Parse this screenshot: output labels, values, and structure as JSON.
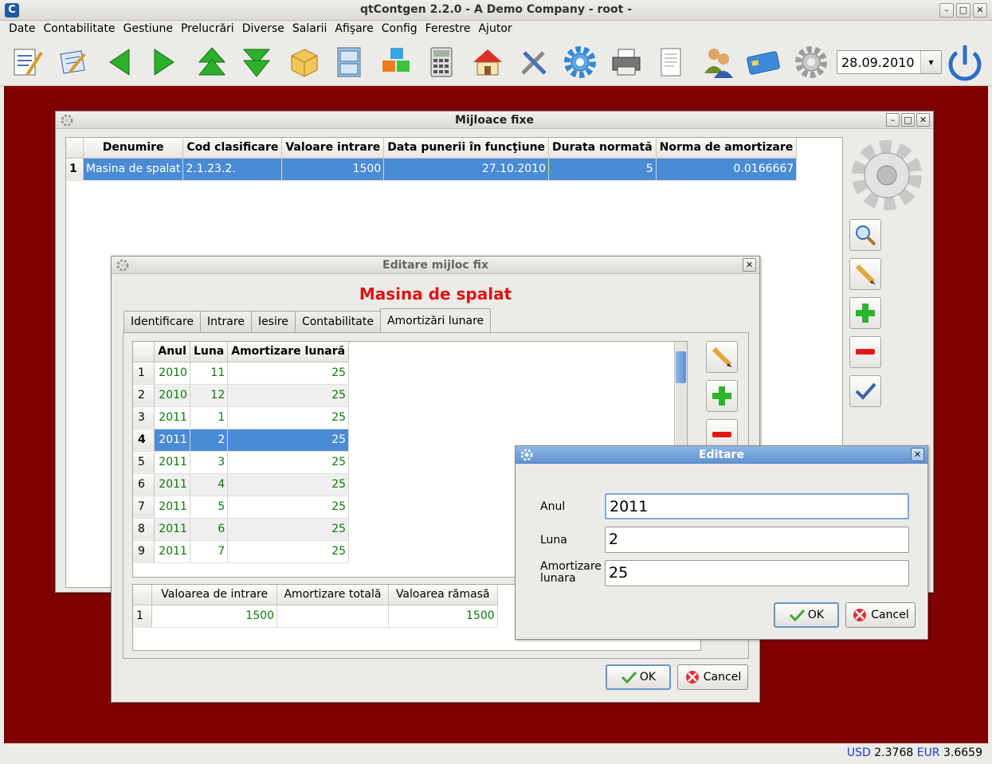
{
  "app": {
    "title": "qtContgen 2.2.0 - A Demo Company - root -",
    "logo_letter": "C",
    "menu": [
      "Date",
      "Contabilitate",
      "Gestiune",
      "Prelucrări",
      "Diverse",
      "Salarii",
      "Afişare",
      "Config",
      "Ferestre",
      "Ajutor"
    ],
    "date": "28.09.2010",
    "status": {
      "usd_label": "USD",
      "usd_value": "2.3768",
      "eur_label": "EUR",
      "eur_value": "3.6659"
    }
  },
  "toolbar": {
    "icons": [
      "document-edit-icon",
      "notepad-edit-icon",
      "arrow-left-icon",
      "arrow-right-icon",
      "arrow-up-icon",
      "arrow-down-icon",
      "box-icon",
      "cabinet-icon",
      "cubes-icon",
      "calculator-icon",
      "house-icon",
      "tools-icon",
      "gear-blue-icon",
      "printer-icon",
      "report-icon",
      "users-icon",
      "card-icon",
      "gear-grey-icon",
      "power-icon"
    ]
  },
  "mijloace": {
    "title": "Mijloace fixe",
    "columns": [
      "Denumire",
      "Cod clasificare",
      "Valoare intrare",
      "Data punerii în funcţiune",
      "Durata normată",
      "Norma de amortizare"
    ],
    "rows": [
      {
        "n": "1",
        "cells": [
          "Masina de spalat",
          "2.1.23.2.",
          "1500",
          "27.10.2010",
          "5",
          "0.0166667"
        ]
      }
    ]
  },
  "editare_mijloc": {
    "title": "Editare mijloc fix",
    "heading": "Masina de spalat",
    "tabs": [
      "Identificare",
      "Intrare",
      "Iesire",
      "Contabilitate",
      "Amortizări lunare"
    ],
    "active_tab": 4,
    "columns": [
      "Anul",
      "Luna",
      "Amortizare lunară"
    ],
    "rows": [
      {
        "n": "1",
        "anul": "2010",
        "luna": "11",
        "amort": "25"
      },
      {
        "n": "2",
        "anul": "2010",
        "luna": "12",
        "amort": "25"
      },
      {
        "n": "3",
        "anul": "2011",
        "luna": "1",
        "amort": "25"
      },
      {
        "n": "4",
        "anul": "2011",
        "luna": "2",
        "amort": "25"
      },
      {
        "n": "5",
        "anul": "2011",
        "luna": "3",
        "amort": "25"
      },
      {
        "n": "6",
        "anul": "2011",
        "luna": "4",
        "amort": "25"
      },
      {
        "n": "7",
        "anul": "2011",
        "luna": "5",
        "amort": "25"
      },
      {
        "n": "8",
        "anul": "2011",
        "luna": "6",
        "amort": "25"
      },
      {
        "n": "9",
        "anul": "2011",
        "luna": "7",
        "amort": "25"
      }
    ],
    "selected_row": 3,
    "summary_columns": [
      "Valoarea de intrare",
      "Amortizare totală",
      "Valoarea rămasă"
    ],
    "summary_rows": [
      {
        "n": "1",
        "cells": [
          "1500",
          "",
          "1500"
        ]
      }
    ],
    "ok_label": "OK",
    "cancel_label": "Cancel"
  },
  "editare": {
    "title": "Editare",
    "anul_label": "Anul",
    "anul_value": "2011",
    "luna_label": "Luna",
    "luna_value": "2",
    "amort_label": "Amortizare lunara",
    "amort_value": "25",
    "ok_label": "OK",
    "cancel_label": "Cancel"
  },
  "colors": {
    "workspace": "#800000",
    "heading_red": "#e01010",
    "selection": "#4a8bd6",
    "value_green": "#0b7a0b"
  }
}
